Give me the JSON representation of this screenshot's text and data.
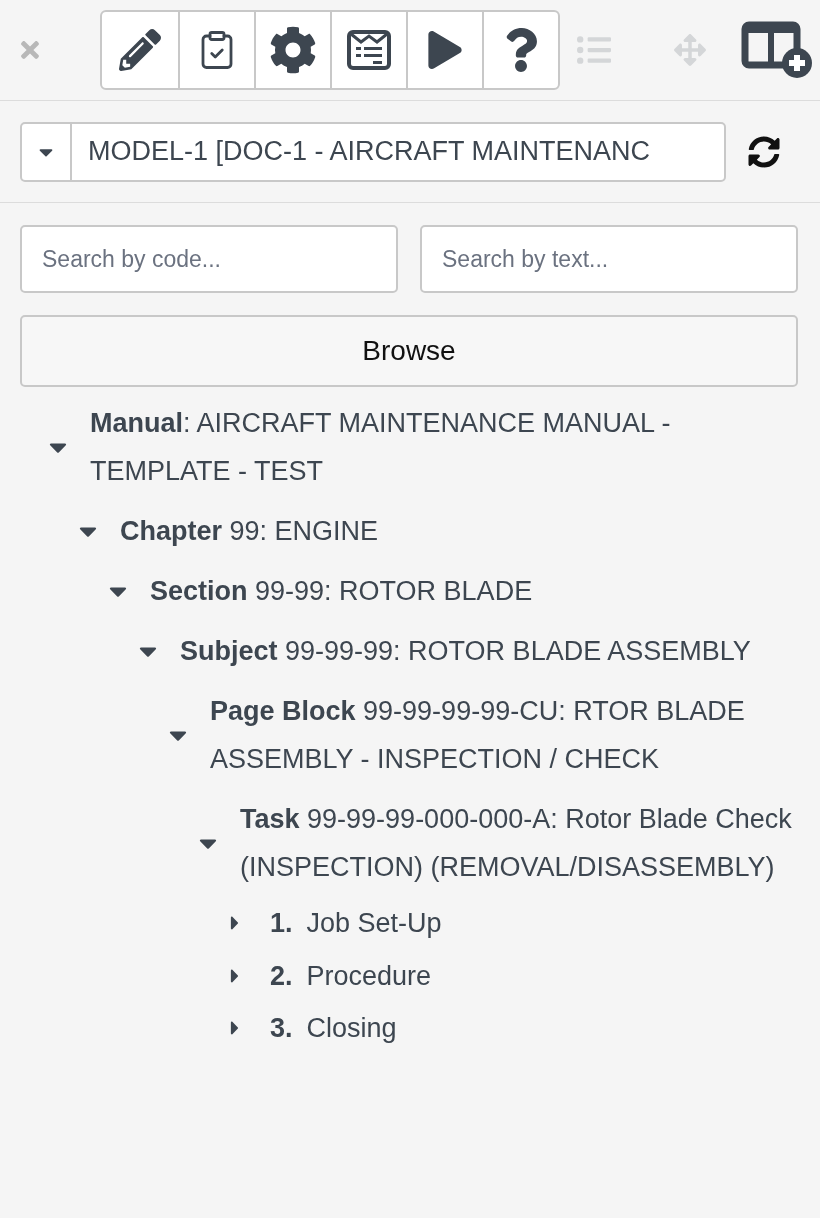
{
  "toolbar": {
    "tools": [
      {
        "kind": "edit",
        "disabled": false
      },
      {
        "kind": "checklist",
        "disabled": false
      },
      {
        "kind": "settings",
        "disabled": false
      },
      {
        "kind": "form",
        "disabled": false
      },
      {
        "kind": "play",
        "disabled": false
      },
      {
        "kind": "help",
        "disabled": false
      }
    ],
    "side_tools": [
      {
        "kind": "list",
        "disabled": true
      },
      {
        "kind": "move",
        "disabled": true
      },
      {
        "kind": "add-column",
        "disabled": false
      }
    ]
  },
  "document_select": {
    "value": "MODEL-1 [DOC-1 - AIRCRAFT MAINTENANC"
  },
  "search": [
    {
      "placeholder": "Search by code..."
    },
    {
      "placeholder": "Search by text..."
    }
  ],
  "browse_button": "Browse",
  "tree": [
    {
      "text": "**Manual**: AIRCRAFT MAINTENANCE MANUAL - TEMPLATE - TEST",
      "expanded": true,
      "children": [
        {
          "text": "**Chapter** 99: ENGINE",
          "expanded": true,
          "children": [
            {
              "text": "**Section** 99-99: ROTOR BLADE",
              "expanded": true,
              "children": [
                {
                  "text": "**Subject** 99-99-99: ROTOR BLADE ASSEMBLY",
                  "expanded": true,
                  "children": [
                    {
                      "text": "**Page Block** 99-99-99-99-CU: RTOR BLADE ASSEMBLY - INSPECTION / CHECK",
                      "expanded": true,
                      "children": [
                        {
                          "text": "**Task** 99-99-99-000-000-A: Rotor Blade Check (INSPECTION) (REMOVAL/DISASSEMBLY)",
                          "expanded": true,
                          "children": [
                            {
                              "number": "1.",
                              "title": "Job Set-Up",
                              "expanded": false
                            },
                            {
                              "number": "2.",
                              "title": "Procedure",
                              "expanded": false
                            },
                            {
                              "number": "3.",
                              "title": "Closing",
                              "expanded": false
                            }
                          ]
                        }
                      ]
                    }
                  ]
                }
              ]
            }
          ]
        }
      ]
    }
  ]
}
